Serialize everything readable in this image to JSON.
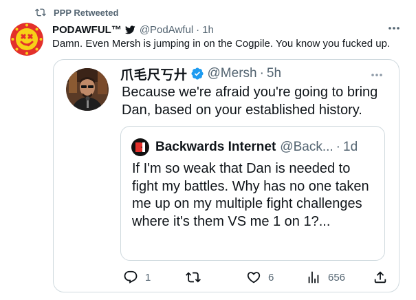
{
  "retweet": {
    "label": "PPP Retweeted",
    "icon": "retweet-icon"
  },
  "tweet": {
    "name": "PODAWFUL™",
    "handle": "@PodAwful",
    "separator": "·",
    "time": "1h",
    "text": "Damn. Even Mersh is jumping in on the Cogpile. You know you fucked up.",
    "more_icon": "more-icon",
    "badge_icon": "bird-icon"
  },
  "quote": {
    "name": "爪毛尺丂廾",
    "handle": "@Mersh",
    "separator": "·",
    "time": "5h",
    "text": "Because we're afraid you're going to bring Dan, based on your established history.",
    "verified_icon": "verified-badge-icon",
    "more_icon": "more-icon"
  },
  "inner_quote": {
    "name": "Backwards Internet",
    "handle": "@Back...",
    "separator": "·",
    "time": "1d",
    "text": "If I'm so weak that Dan is needed to fight my battles. Why has no one taken me up on my multiple fight challenges where it's them VS me 1 on 1?...",
    "logo_icon": "backwards-internet-logo-icon"
  },
  "actions": {
    "reply_count": "1",
    "retweet_count": "",
    "like_count": "6",
    "views_count": "656"
  },
  "colors": {
    "text_primary": "#0f1419",
    "text_secondary": "#536471",
    "border": "#cfd9de",
    "verified": "#1d9bf0",
    "avatar_red": "#e3302b",
    "avatar_yellow": "#f7d117"
  }
}
